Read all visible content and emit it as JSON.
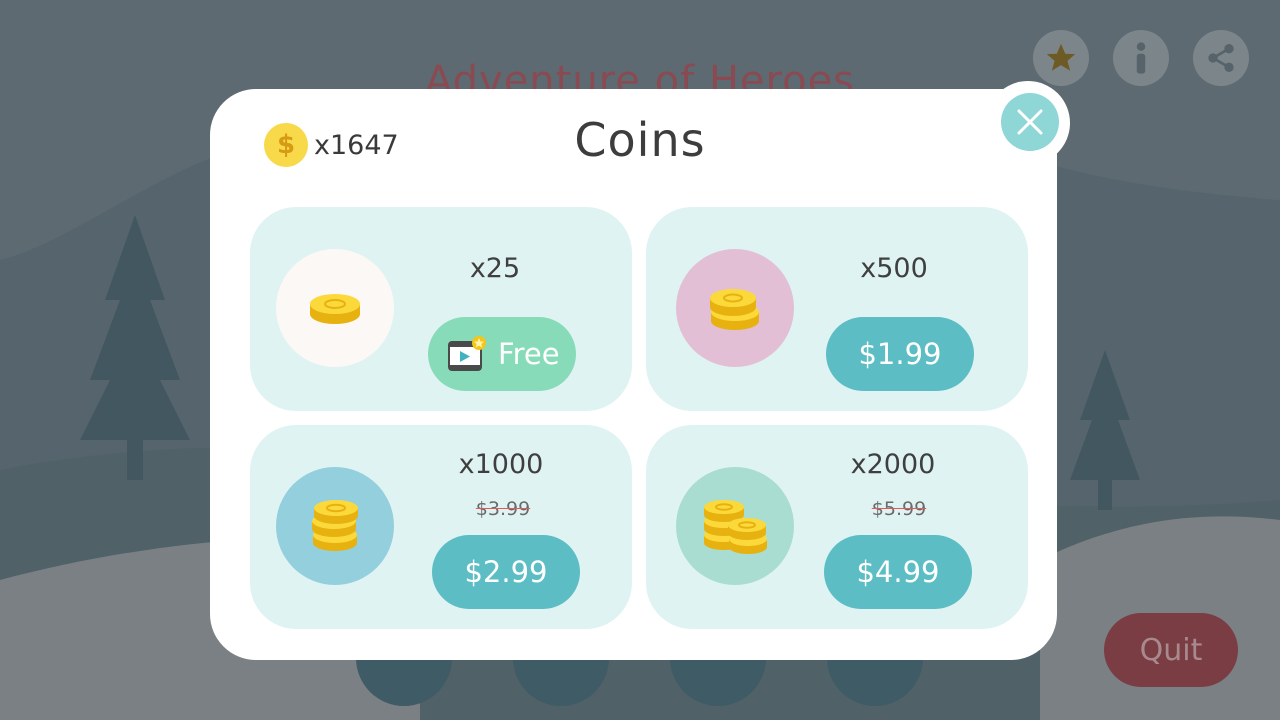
{
  "background": {
    "title": "Adventure of Heroes",
    "quit_label": "Quit",
    "icons": [
      "star-icon",
      "info-icon",
      "share-icon"
    ]
  },
  "dialog": {
    "title": "Coins",
    "balance": "x1647",
    "balance_icon": "dollar-coin-icon",
    "close_icon": "close-icon"
  },
  "offers": [
    {
      "quantity": "x25",
      "button_label": "Free",
      "button_icon": "video-ad-icon",
      "icon_bg": "#fcf8f6"
    },
    {
      "quantity": "x500",
      "button_label": "$1.99",
      "icon_bg": "#e2bfd5"
    },
    {
      "quantity": "x1000",
      "old_price": "$3.99",
      "button_label": "$2.99",
      "icon_bg": "#93cfdc"
    },
    {
      "quantity": "x2000",
      "old_price": "$5.99",
      "button_label": "$4.99",
      "icon_bg": "#a9ddd1"
    }
  ],
  "colors": {
    "dialog_bg": "#ffffff",
    "card_bg": "#dff3f3",
    "buy_button": "#5cbec4",
    "free_button": "#88dbb8",
    "close_button": "#8fd6d6",
    "overlay": "#5d6a72"
  }
}
